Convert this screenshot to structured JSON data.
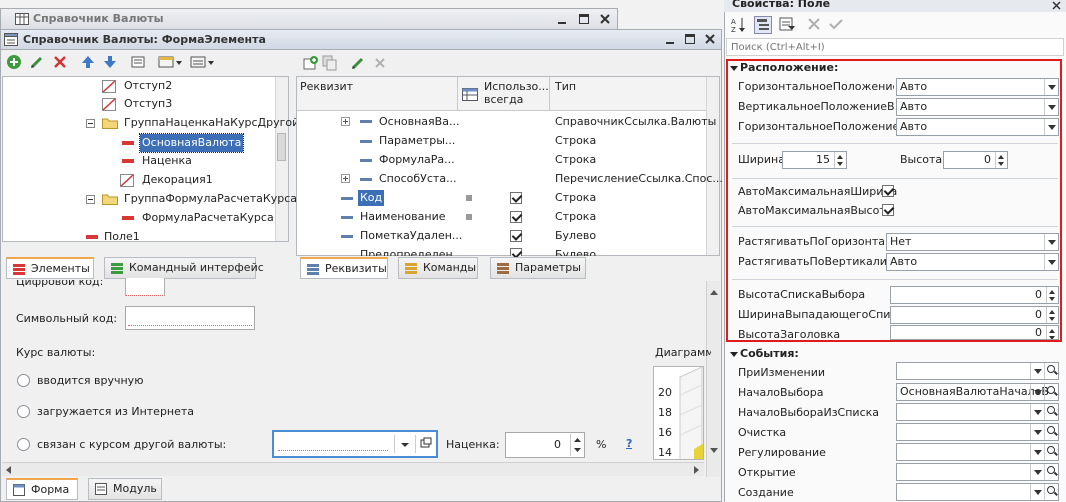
{
  "bg_window": {
    "title": "Справочник Валюты"
  },
  "form_window": {
    "title": "Справочник Валюты: ФормаЭлемента"
  },
  "elements_tree": {
    "items": [
      {
        "label": "Отступ2",
        "kind": "decoration"
      },
      {
        "label": "Отступ3",
        "kind": "decoration"
      },
      {
        "label": "ГруппаНаценкаНаКурсДругой",
        "kind": "group"
      },
      {
        "label": "ОсновнаяВалюта",
        "kind": "field",
        "selected": true
      },
      {
        "label": "Наценка",
        "kind": "field"
      },
      {
        "label": "Декорация1",
        "kind": "decoration"
      },
      {
        "label": "ГруппаФормулаРасчетаКурса",
        "kind": "group"
      },
      {
        "label": "ФормулаРасчетаКурса",
        "kind": "field"
      },
      {
        "label": "Поле1",
        "kind": "field"
      }
    ],
    "tabs": [
      "Элементы",
      "Командный интерфейс"
    ]
  },
  "attributes": {
    "columns": [
      "Реквизит",
      "Использо... всегда",
      "Тип"
    ],
    "rows": [
      {
        "name": "ОсновнаяВа...",
        "type": "СправочникСсылка.Валюты",
        "expandable": true
      },
      {
        "name": "Параметры...",
        "type": "Строка"
      },
      {
        "name": "ФормулаРа...",
        "type": "Строка"
      },
      {
        "name": "СпособУста...",
        "type": "ПеречислениеСсылка.Спос...",
        "expandable": true
      },
      {
        "name": "Код",
        "type": "Строка",
        "checked": true,
        "selected": true
      },
      {
        "name": "Наименование",
        "type": "Строка",
        "checked": true
      },
      {
        "name": "ПометкаУдален...",
        "type": "Булево",
        "checked": true
      },
      {
        "name": "Предопределен...",
        "type": "Булево",
        "checked": true
      }
    ],
    "tabs": [
      "Реквизиты",
      "Команды",
      "Параметры"
    ]
  },
  "preview": {
    "digital_code_label": "Цифровой код:",
    "symbol_code_label": "Символьный код:",
    "rate_label": "Курс валюты:",
    "radio_options": [
      "вводится вручную",
      "загружается из Интернета",
      "связан с курсом другой валюты:"
    ],
    "markup_label": "Наценка:",
    "markup_value": "0",
    "percent": "%",
    "help": "?",
    "diagram_label": "Диаграмм",
    "diagram_ticks": [
      "20",
      "18",
      "16",
      "14"
    ],
    "bottom_tabs": [
      "Форма",
      "Модуль"
    ]
  },
  "properties": {
    "title": "Свойства: Поле",
    "search_placeholder": "Поиск (Ctrl+Alt+I)",
    "location_header": "Расположение:",
    "h_pos_group_label": "ГоризонтальноеПоложениеВГр",
    "h_pos_group_value": "Авто",
    "v_pos_group_label": "ВертикальноеПоложениеВГруп",
    "v_pos_group_value": "Авто",
    "h_pos_label": "ГоризонтальноеПоложение",
    "h_pos_value": "Авто",
    "width_label": "Ширина",
    "width_value": "15",
    "height_label": "Высота",
    "height_value": "0",
    "auto_max_width_label": "АвтоМаксимальнаяШирина",
    "auto_max_height_label": "АвтоМаксимальнаяВысота",
    "stretch_h_label": "РастягиватьПоГоризонтали",
    "stretch_h_value": "Нет",
    "stretch_v_label": "РастягиватьПоВертикали",
    "stretch_v_value": "Авто",
    "list_height_label": "ВысотаСпискаВыбора",
    "list_height_value": "0",
    "dropdown_width_label": "ШиринаВыпадающегоСписка",
    "dropdown_width_value": "0",
    "header_height_label": "ВысотаЗаголовка",
    "header_height_value": "0",
    "events_header": "События:",
    "events": [
      {
        "label": "ПриИзменении",
        "value": ""
      },
      {
        "label": "НачалоВыбора",
        "value": "ОсновнаяВалютаНачалоВ"
      },
      {
        "label": "НачалоВыбораИзСписка",
        "value": ""
      },
      {
        "label": "Очистка",
        "value": ""
      },
      {
        "label": "Регулирование",
        "value": ""
      },
      {
        "label": "Открытие",
        "value": ""
      },
      {
        "label": "Создание",
        "value": ""
      }
    ]
  },
  "colors": {
    "highlight_border": "#e01b1b",
    "selection": "#3d6fb6",
    "accent_tab": "#f0a64a"
  }
}
